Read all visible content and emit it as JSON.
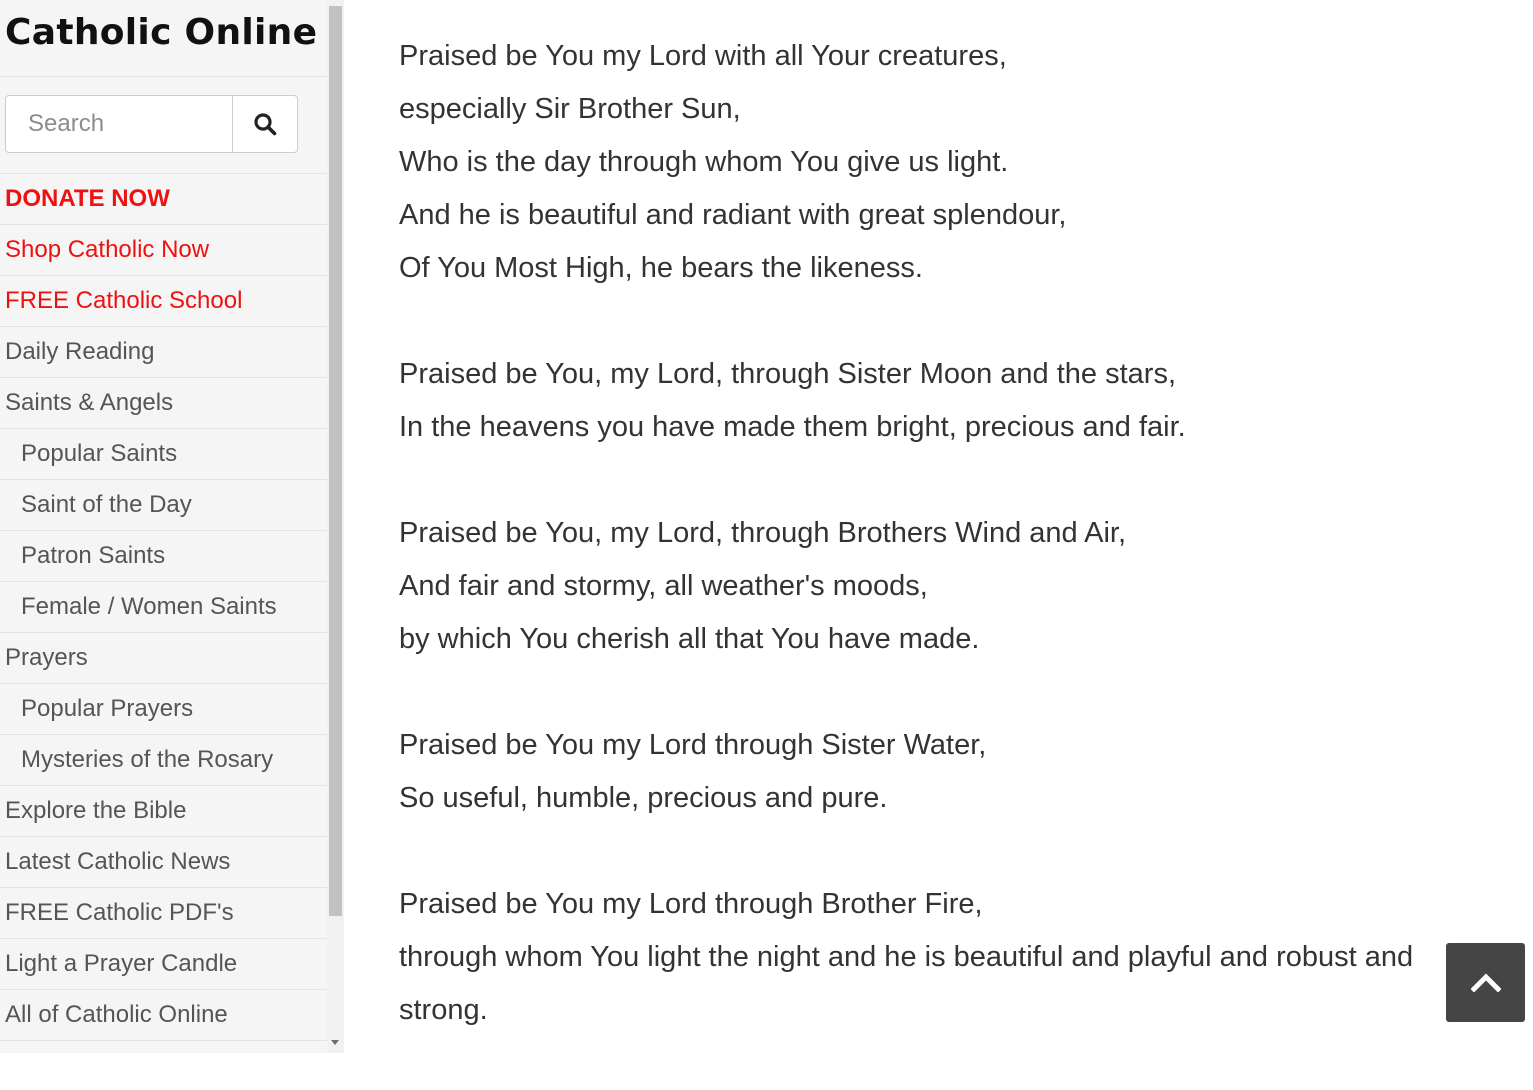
{
  "site": {
    "logo": "Catholic Online"
  },
  "search": {
    "placeholder": "Search",
    "button_icon": "magnifier-icon"
  },
  "menu": [
    {
      "label": "DONATE NOW",
      "style": "accent-bold"
    },
    {
      "label": "Shop Catholic Now",
      "style": "accent"
    },
    {
      "label": "FREE Catholic School",
      "style": "accent"
    },
    {
      "label": "Daily Reading",
      "style": "normal"
    },
    {
      "label": "Saints & Angels",
      "style": "normal"
    },
    {
      "label": "Popular Saints",
      "style": "sub"
    },
    {
      "label": "Saint of the Day",
      "style": "sub"
    },
    {
      "label": "Patron Saints",
      "style": "sub"
    },
    {
      "label": "Female / Women Saints",
      "style": "sub"
    },
    {
      "label": "Prayers",
      "style": "normal"
    },
    {
      "label": "Popular Prayers",
      "style": "sub"
    },
    {
      "label": "Mysteries of the Rosary",
      "style": "sub"
    },
    {
      "label": "Explore the Bible",
      "style": "normal"
    },
    {
      "label": "Latest Catholic News",
      "style": "normal"
    },
    {
      "label": "FREE Catholic PDF's",
      "style": "normal"
    },
    {
      "label": "Light a Prayer Candle",
      "style": "normal"
    },
    {
      "label": "All of Catholic Online",
      "style": "normal"
    }
  ],
  "prayer": {
    "stanzas": [
      [
        "Praised be You my Lord with all Your creatures,",
        "especially Sir Brother Sun,",
        "Who is the day through whom You give us light.",
        "And he is beautiful and radiant with great splendour,",
        "Of You Most High, he bears the likeness."
      ],
      [
        "Praised be You, my Lord, through Sister Moon and the stars,",
        "In the heavens you have made them bright, precious and fair."
      ],
      [
        "Praised be You, my Lord, through Brothers Wind and Air,",
        "And fair and stormy, all weather's moods,",
        "by which You cherish all that You have made."
      ],
      [
        "Praised be You my Lord through Sister Water,",
        "So useful, humble, precious and pure."
      ],
      [
        "Praised be You my Lord through Brother Fire,",
        "through whom You light the night and he is beautiful and playful and robust and",
        "strong."
      ]
    ]
  },
  "back_to_top": {
    "icon": "chevron-up-icon"
  },
  "colors": {
    "accent": "#ee1111",
    "sidebar_bg": "#f5f5f5",
    "text": "#333333",
    "menu_text": "#555555",
    "back_to_top_bg": "#454545"
  }
}
